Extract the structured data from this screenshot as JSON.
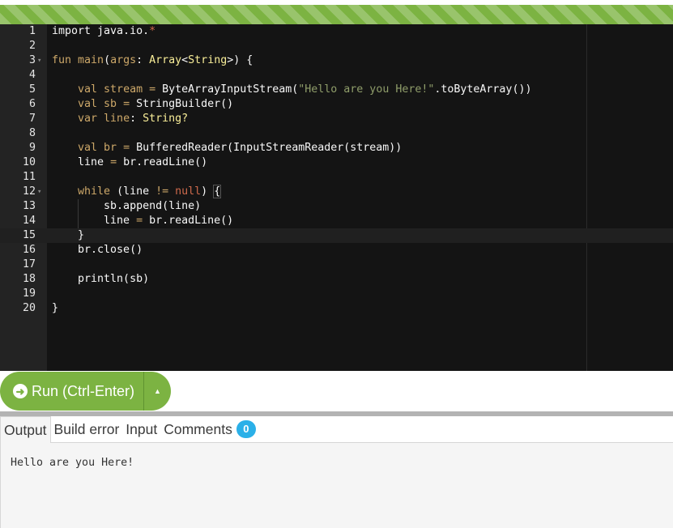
{
  "editor": {
    "active_line": 15,
    "lines": [
      {
        "num": "1",
        "fold": false,
        "tokens": [
          {
            "t": "import java.io.",
            "c": "plain"
          },
          {
            "t": "*",
            "c": "cnst"
          }
        ]
      },
      {
        "num": "2",
        "fold": false,
        "tokens": []
      },
      {
        "num": "3",
        "fold": true,
        "tokens": [
          {
            "t": "fun ",
            "c": "kw"
          },
          {
            "t": "main",
            "c": "kw"
          },
          {
            "t": "(",
            "c": "plain"
          },
          {
            "t": "args",
            "c": "kw"
          },
          {
            "t": ": ",
            "c": "plain"
          },
          {
            "t": "Array",
            "c": "typ"
          },
          {
            "t": "<",
            "c": "plain"
          },
          {
            "t": "String",
            "c": "typ"
          },
          {
            "t": ">) {",
            "c": "plain"
          }
        ]
      },
      {
        "num": "4",
        "fold": false,
        "tokens": []
      },
      {
        "num": "5",
        "fold": false,
        "tokens": [
          {
            "t": "    val ",
            "c": "kw"
          },
          {
            "t": "stream",
            "c": "kw"
          },
          {
            "t": " = ",
            "c": "kw"
          },
          {
            "t": "ByteArrayInputStream",
            "c": "plain"
          },
          {
            "t": "(",
            "c": "plain"
          },
          {
            "t": "\"Hello are you Here!\"",
            "c": "str"
          },
          {
            "t": ".toByteArray())",
            "c": "plain"
          }
        ]
      },
      {
        "num": "6",
        "fold": false,
        "tokens": [
          {
            "t": "    val ",
            "c": "kw"
          },
          {
            "t": "sb",
            "c": "kw"
          },
          {
            "t": " = ",
            "c": "kw"
          },
          {
            "t": "StringBuilder()",
            "c": "plain"
          }
        ]
      },
      {
        "num": "7",
        "fold": false,
        "tokens": [
          {
            "t": "    var ",
            "c": "kw"
          },
          {
            "t": "line",
            "c": "kw"
          },
          {
            "t": ": ",
            "c": "plain"
          },
          {
            "t": "String?",
            "c": "typ"
          }
        ]
      },
      {
        "num": "8",
        "fold": false,
        "tokens": []
      },
      {
        "num": "9",
        "fold": false,
        "tokens": [
          {
            "t": "    val ",
            "c": "kw"
          },
          {
            "t": "br",
            "c": "kw"
          },
          {
            "t": " = ",
            "c": "kw"
          },
          {
            "t": "BufferedReader(InputStreamReader(stream))",
            "c": "plain"
          }
        ]
      },
      {
        "num": "10",
        "fold": false,
        "tokens": [
          {
            "t": "    line ",
            "c": "plain"
          },
          {
            "t": "= ",
            "c": "kw"
          },
          {
            "t": "br.readLine()",
            "c": "plain"
          }
        ]
      },
      {
        "num": "11",
        "fold": false,
        "tokens": []
      },
      {
        "num": "12",
        "fold": true,
        "tokens": [
          {
            "t": "    while ",
            "c": "kw"
          },
          {
            "t": "(line ",
            "c": "plain"
          },
          {
            "t": "!= ",
            "c": "kw"
          },
          {
            "t": "null",
            "c": "cnst"
          },
          {
            "t": ") ",
            "c": "plain"
          },
          {
            "t": "{",
            "c": "bracket"
          }
        ]
      },
      {
        "num": "13",
        "fold": false,
        "tokens": [
          {
            "t": "        sb.append(line)",
            "c": "plain"
          }
        ]
      },
      {
        "num": "14",
        "fold": false,
        "tokens": [
          {
            "t": "        line ",
            "c": "plain"
          },
          {
            "t": "= ",
            "c": "kw"
          },
          {
            "t": "br.readLine()",
            "c": "plain"
          }
        ]
      },
      {
        "num": "15",
        "fold": false,
        "tokens": [
          {
            "t": "    }",
            "c": "plain"
          }
        ]
      },
      {
        "num": "16",
        "fold": false,
        "tokens": [
          {
            "t": "    br.close()",
            "c": "plain"
          }
        ]
      },
      {
        "num": "17",
        "fold": false,
        "tokens": []
      },
      {
        "num": "18",
        "fold": false,
        "tokens": [
          {
            "t": "    println(sb)",
            "c": "plain"
          }
        ]
      },
      {
        "num": "19",
        "fold": false,
        "tokens": []
      },
      {
        "num": "20",
        "fold": false,
        "tokens": [
          {
            "t": "}",
            "c": "plain"
          }
        ]
      }
    ]
  },
  "toolbar": {
    "run_label": "Run (Ctrl-Enter)",
    "run_icon": "circle-arrow-right-icon",
    "dropdown_icon": "caret-up-icon"
  },
  "tabs": {
    "output": "Output",
    "build_error": "Build error",
    "input": "Input",
    "comments": "Comments",
    "comments_count": "0"
  },
  "output": {
    "text": "Hello are you Here!"
  },
  "colors": {
    "accent": "#7cb342",
    "badge": "#2bb0e8",
    "editor_bg": "#141414",
    "gutter_bg": "#232323"
  }
}
